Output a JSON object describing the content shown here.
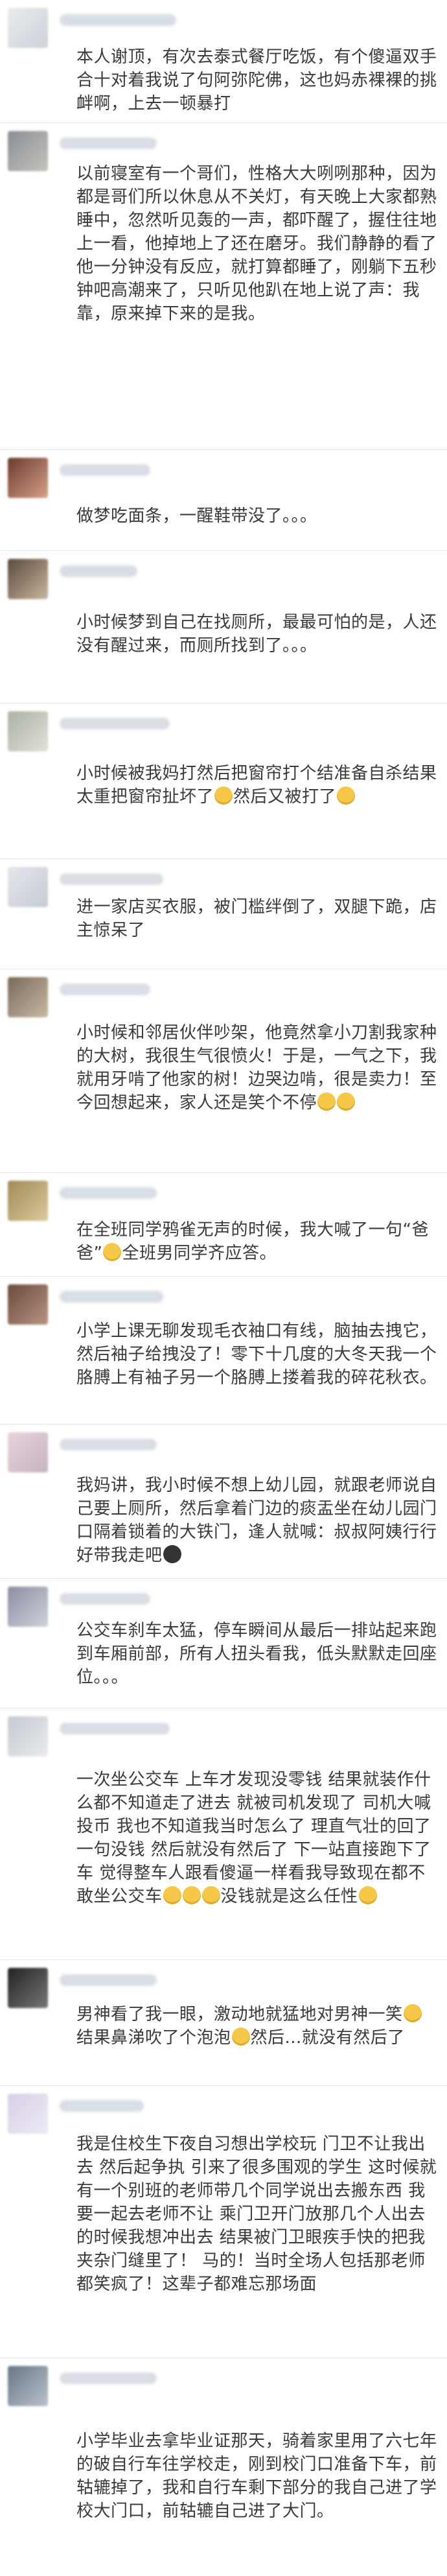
{
  "comments": [
    {
      "text": "本人谢顶，有次去泰式餐厅吃饭，有个傻逼双手合十对着我说了句阿弥陀佛，这也妈赤裸裸的挑衅啊，上去一顿暴打",
      "emojis": []
    },
    {
      "text": "以前寝室有一个哥们，性格大大咧咧那种，因为都是哥们所以休息从不关灯，有天晚上大家都熟睡中，忽然听见轰的一声，都吓醒了，握住往地上一看，他掉地上了还在磨牙。我们静静的看了他一分钟没有反应，就打算都睡了，刚躺下五秒钟吧高潮来了，只听见他趴在地上说了声：我靠，原来掉下来的是我。",
      "emojis": []
    },
    {
      "text": "做梦吃面条，一醒鞋带没了。。。",
      "emojis": []
    },
    {
      "text": "小时候梦到自己在找厕所，最最可怕的是，人还没有醒过来，而厕所找到了。。。",
      "emojis": []
    },
    {
      "text": "小时候被我妈打然后把窗帘打个结准备自杀结果太重把窗帘扯坏了",
      "text2": "然后又被打了",
      "emojis": [
        "smile",
        "smile"
      ]
    },
    {
      "text": "进一家店买衣服，被门槛绊倒了，双腿下跪，店主惊呆了",
      "emojis": []
    },
    {
      "text": "小时候和邻居伙伴吵架，他竟然拿小刀割我家种的大树，我很生气很愤火！于是，一气之下，我就用牙啃了他家的树！边哭边啃，很是卖力！至今回想起来，家人还是笑个不停",
      "emojis": [
        "laugh",
        "laugh"
      ]
    },
    {
      "text": "在全班同学鸦雀无声的时候，我大喊了一句“爸爸”",
      "text2": "全班男同学齐应答。",
      "emojis": [
        "smile"
      ]
    },
    {
      "text": "小学上课无聊发现毛衣袖口有线，脑抽去拽它，然后袖子给拽没了！零下十几度的大冬天我一个胳膊上有袖子另一个胳膊上搂着我的碎花秋衣。",
      "emojis": []
    },
    {
      "text": "我妈讲，我小时候不想上幼儿园，就跟老师说自己要上厕所，然后拿着门边的痰盂坐在幼儿园门口隔着锁着的大铁门，逢人就喊：叔叔阿姨行行好带我走吧",
      "emojis": [
        "dark"
      ]
    },
    {
      "text": "公交车刹车太猛，停车瞬间从最后一排站起来跑到车厢前部，所有人扭头看我，低头默默走回座位。。。",
      "emojis": []
    },
    {
      "text": "一次坐公交车 上车才发现没零钱 结果就装作什么都不知道走了进去 就被司机发现了 司机大喊投币 我也不知道我当时怎么了 理直气壮的回了一句没钱 然后就没有然后了 下一站直接跑下了车 觉得整车人跟看傻逼一样看我导致现在都不敢坐公交车",
      "text2": "没钱就是这么任性",
      "emojis": [
        "laugh",
        "laugh",
        "laugh",
        "laugh"
      ]
    },
    {
      "text": "男神看了我一眼，激动地就猛地对男神一笑",
      "text2": "结果鼻涕吹了个泡泡",
      "text3": "然后...就没有然后了",
      "emojis": [
        "smile",
        "smile"
      ]
    },
    {
      "text": "我是住校生下夜自习想出学校玩 门卫不让我出去 然后起争执 引来了很多围观的学生 这时候就有一个别班的老师带几个同学说出去搬东西 我要一起去老师不让 乘门卫开门放那几个人出去的时候我想冲出去 结果被门卫眼疾手快的把我夹杂门缝里了！ 马的！当时全场人包括那老师都笑疯了！这辈子都难忘那场面",
      "emojis": []
    },
    {
      "text": "小学毕业去拿毕业证那天，骑着家里用了六七年的破自行车往学校走，刚到校门口准备下车，前轱辘掉了，我和自行车剩下部分的我自己进了学校大门口，前轱辘自己进了大门。",
      "emojis": []
    }
  ],
  "colors": {
    "text": "#3a3a3a",
    "divider": "#e6e6e6",
    "emoji": "#f5c84a"
  }
}
